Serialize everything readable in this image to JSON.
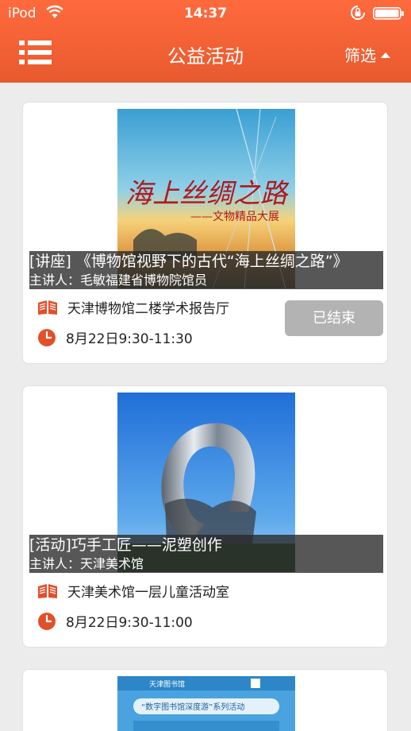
{
  "status_bar": {
    "carrier": "iPod",
    "time": "14:37"
  },
  "nav": {
    "title": "公益活动",
    "filter_label": "筛选"
  },
  "theme": {
    "accent": "#ee5f30",
    "icon_color": "#e0502b",
    "ended_button": "#b3b3b3"
  },
  "events": [
    {
      "title": "[讲座] 《博物馆视野下的古代“海上丝绸之路”》",
      "speaker": "主讲人：毛敏福建省博物院馆员",
      "location": "天津博物馆二楼学术报告厅",
      "time": "8月22日9:30-11:30",
      "status": "已结束",
      "poster": {
        "title": "海上丝绸之路",
        "subtitle": "——文物精品大展"
      }
    },
    {
      "title": "[活动]巧手工匠——泥塑创作",
      "speaker": "主讲人：天津美术馆",
      "location": "天津美术馆一层儿童活动室",
      "time": "8月22日9:30-11:00"
    },
    {
      "poster": {
        "org": "天津图书馆",
        "title": "“数字图书馆深度游”系列活动"
      }
    }
  ]
}
